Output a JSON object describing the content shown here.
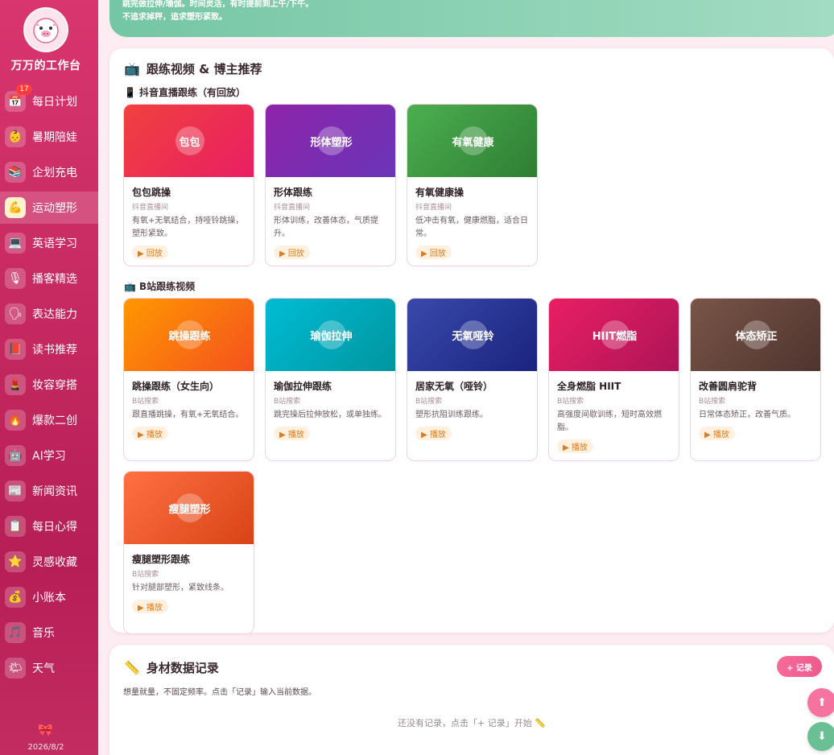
{
  "app": {
    "title": "万万的工作台",
    "date": "2026/8/2",
    "logo_icon": "pig-face-icon"
  },
  "sidebar": {
    "items": [
      {
        "label": "每日计划",
        "icon": "📅",
        "badge": "17"
      },
      {
        "label": "暑期陪娃",
        "icon": "👶"
      },
      {
        "label": "企划充电",
        "icon": "📚"
      },
      {
        "label": "运动塑形",
        "icon": "💪",
        "active": true
      },
      {
        "label": "英语学习",
        "icon": "💻"
      },
      {
        "label": "播客精选",
        "icon": "🎙"
      },
      {
        "label": "表达能力",
        "icon": "🗣"
      },
      {
        "label": "读书推荐",
        "icon": "📕"
      },
      {
        "label": "妆容穿搭",
        "icon": "💄"
      },
      {
        "label": "爆款二创",
        "icon": "🔥"
      },
      {
        "label": "AI学习",
        "icon": "🤖"
      },
      {
        "label": "新闻资讯",
        "icon": "📰"
      },
      {
        "label": "每日心得",
        "icon": "📋"
      },
      {
        "label": "灵感收藏",
        "icon": "⭐"
      },
      {
        "label": "小账本",
        "icon": "💰"
      },
      {
        "label": "音乐",
        "icon": "🎵"
      },
      {
        "label": "天气",
        "icon": "🌤"
      }
    ]
  },
  "banner": {
    "line1": "跳完做拉伸/瑜伽。时间灵活，有时提前到上午/下午。",
    "line2": "不追求掉秤，追求塑形紧致。"
  },
  "videos": {
    "title": "跟练视频 & 博主推荐",
    "douyin_title": "抖音直播跟练（有回放）",
    "bili_title": "B站跟练视频",
    "douyin_cards": [
      {
        "thumb": "包包",
        "name": "包包跳操",
        "source": "抖音直播间",
        "desc": "有氧+无氧结合，持哑铃跳操，塑形紧致。",
        "button": "▶ 回放",
        "color1": "#f0413e",
        "color2": "#e91e63"
      },
      {
        "thumb": "形体塑形",
        "name": "形体跟练",
        "source": "抖音直播间",
        "desc": "形体训练，改善体态，气质提升。",
        "button": "▶ 回放",
        "color1": "#8e24aa",
        "color2": "#6a35b8"
      },
      {
        "thumb": "有氧健康",
        "name": "有氧健康操",
        "source": "抖音直播间",
        "desc": "低冲击有氧，健康燃脂，适合日常。",
        "button": "▶ 回放",
        "color1": "#4caf50",
        "color2": "#2e7d32"
      }
    ],
    "bili_cards": [
      {
        "thumb": "跳操跟练",
        "name": "跳操跟练（女生向）",
        "source": "B站搜索",
        "desc": "跟直播跳操，有氧+无氧结合。",
        "button": "▶ 播放",
        "color1": "#ff9800",
        "color2": "#f4511e"
      },
      {
        "thumb": "瑜伽拉伸",
        "name": "瑜伽拉伸跟练",
        "source": "B站搜索",
        "desc": "跳完操后拉伸放松，或单独练。",
        "button": "▶ 播放",
        "color1": "#00bcd4",
        "color2": "#00959f"
      },
      {
        "thumb": "无氧哑铃",
        "name": "居家无氧（哑铃）",
        "source": "B站搜索",
        "desc": "塑形抗阻训练跟练。",
        "button": "▶ 播放",
        "color1": "#3949ab",
        "color2": "#1a237e"
      },
      {
        "thumb": "HIIT燃脂",
        "name": "全身燃脂 HIIT",
        "source": "B站搜索",
        "desc": "高强度间歇训练，短时高效燃脂。",
        "button": "▶ 播放",
        "color1": "#e91e63",
        "color2": "#ad1457"
      },
      {
        "thumb": "体态矫正",
        "name": "改善圆肩驼背",
        "source": "B站搜索",
        "desc": "日常体态矫正，改善气质。",
        "button": "▶ 播放",
        "color1": "#795548",
        "color2": "#4e342e"
      },
      {
        "thumb": "瘦腿塑形",
        "name": "瘦腿塑形跟练",
        "source": "B站搜索",
        "desc": "针对腿部塑形，紧致线条。",
        "button": "▶ 播放",
        "color1": "#ff7043",
        "color2": "#d84315"
      }
    ]
  },
  "body_data": {
    "title": "身材数据记录",
    "add_button": "+ 记录",
    "hint": "想量就量，不固定频率。点击「记录」输入当前数据。",
    "empty": "还没有记录，点击「+ 记录」开始 📏"
  },
  "fab": {
    "up": "⬆",
    "down": "⬇",
    "up_color": "#f5739e",
    "down_color": "#6bbf95"
  }
}
